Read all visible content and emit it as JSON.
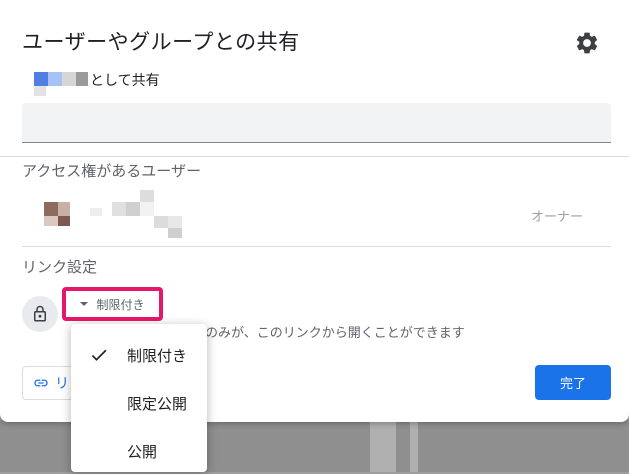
{
  "dialog": {
    "title": "ユーザーやグループとの共有",
    "share_as_label": "として共有",
    "add_people_placeholder": ""
  },
  "people_section": {
    "heading": "アクセス権があるユーザー",
    "owner_role": "オーナー"
  },
  "link_section": {
    "heading": "リンク設定",
    "access_button_label": "制限付き",
    "description": "のみが、このリンクから開くことができます",
    "copy_link_label": "リ"
  },
  "done_button_label": "完了",
  "access_menu": {
    "items": [
      {
        "label": "制限付き",
        "selected": true
      },
      {
        "label": "限定公開",
        "selected": false
      },
      {
        "label": "公開",
        "selected": false
      }
    ]
  },
  "colors": {
    "accent": "#1a73e8",
    "highlight": "#e8166a"
  },
  "icons": {
    "settings": "gear-icon",
    "lock": "lock-icon",
    "link": "link-icon",
    "check": "check-icon",
    "dropdown": "caret-down-icon"
  }
}
